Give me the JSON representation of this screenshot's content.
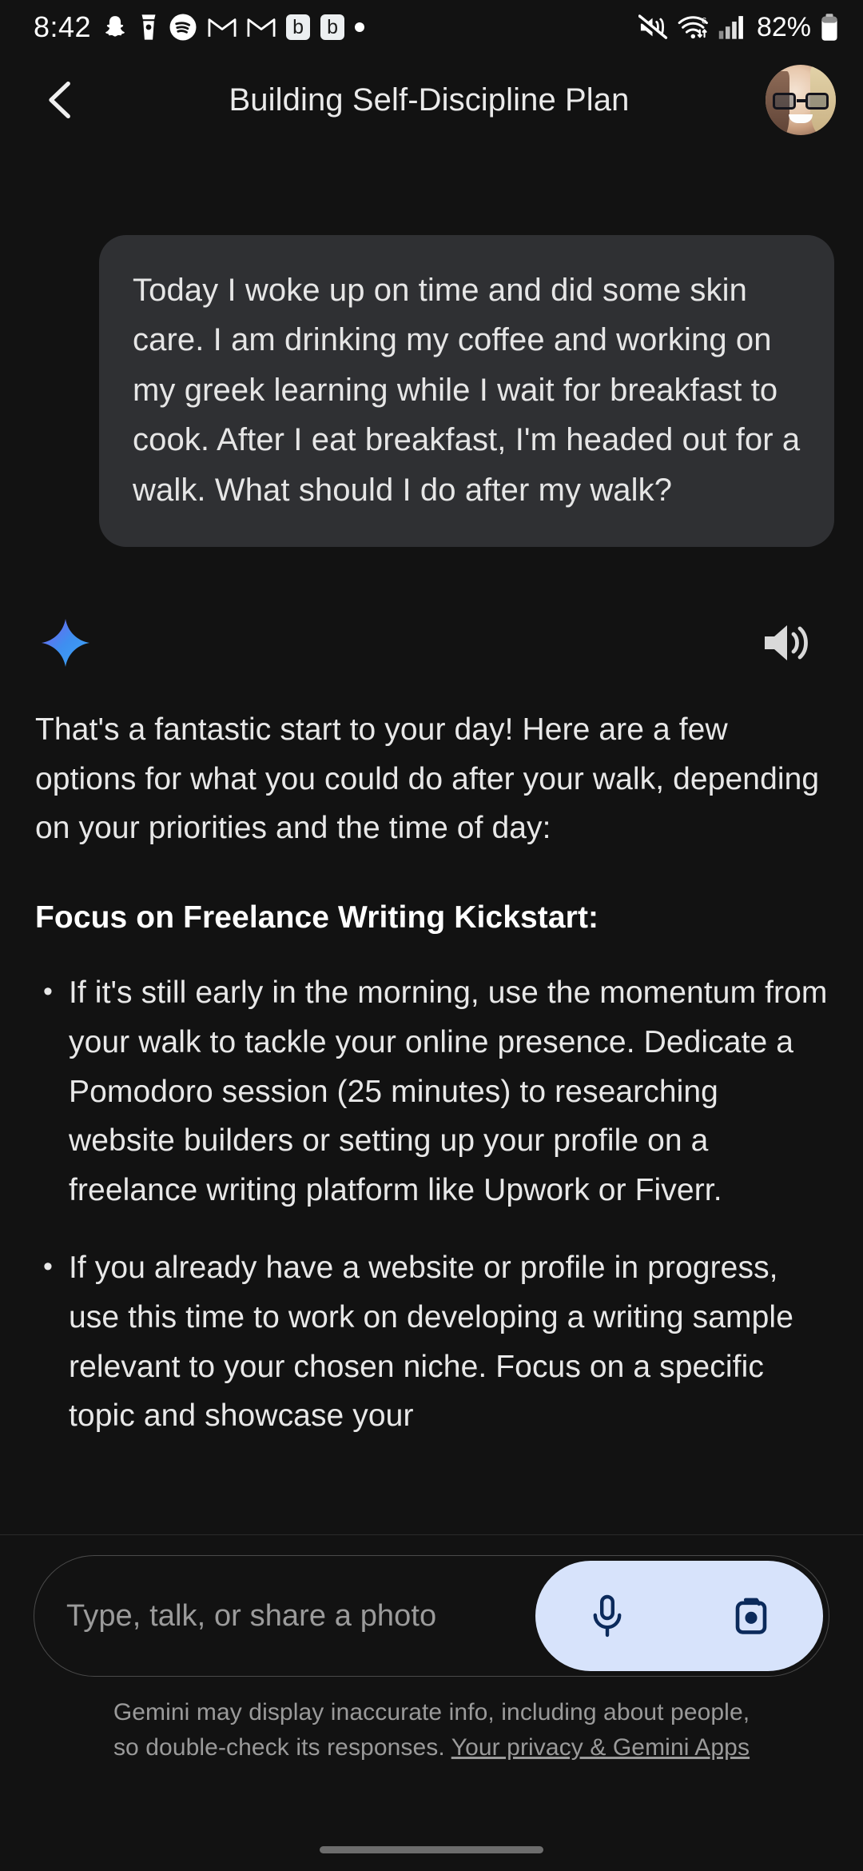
{
  "status_bar": {
    "time": "8:42",
    "left_icons": [
      "snapchat-icon",
      "coffee-cup-icon",
      "spotify-icon",
      "gmail-icon",
      "gmail-icon",
      "b-app-badge",
      "b-app-badge",
      "more-notifications-dot"
    ],
    "b_badge_label": "b",
    "right_icons": [
      "mute-icon",
      "wifi-6-icon",
      "cellular-signal-icon",
      "battery-icon"
    ],
    "battery_percent": "82%"
  },
  "header": {
    "back_icon": "chevron-left-icon",
    "title": "Building Self-Discipline Plan",
    "avatar_icon": "user-avatar"
  },
  "conversation": {
    "user_message": "Today I woke up on time and did some skin care. I am drinking my coffee and working on my greek learning while I wait for breakfast to cook. After I eat breakfast, I'm headed out for a walk. What should I do after my walk?",
    "ai_sparkle_icon": "gemini-sparkle-icon",
    "speaker_icon": "speaker-volume-icon",
    "ai_intro": "That's a fantastic start to your day! Here are a few options for what you could do after your walk, depending on your priorities and the time of day:",
    "ai_heading": "Focus on Freelance Writing Kickstart:",
    "bullet_marker": "•",
    "ai_bullets": [
      "If it's still early in the morning, use the momentum from your walk to tackle your online presence. Dedicate a Pomodoro session (25 minutes) to researching website builders or setting up your profile on a freelance writing platform like Upwork or Fiverr.",
      "If you already have a website or profile in progress, use this time to work on developing a writing sample relevant to your chosen niche. Focus on a specific topic and showcase your"
    ]
  },
  "composer": {
    "placeholder": "Type, talk, or share a photo",
    "mic_icon": "microphone-icon",
    "camera_icon": "camera-icon",
    "action_pill_color": "#d7e3fb",
    "icon_color": "#0b2a5b"
  },
  "footer": {
    "disclaimer_line1": "Gemini may display inaccurate info, including about people,",
    "disclaimer_line2_prefix": "so double-check its responses. ",
    "disclaimer_link": "Your privacy & Gemini Apps"
  }
}
